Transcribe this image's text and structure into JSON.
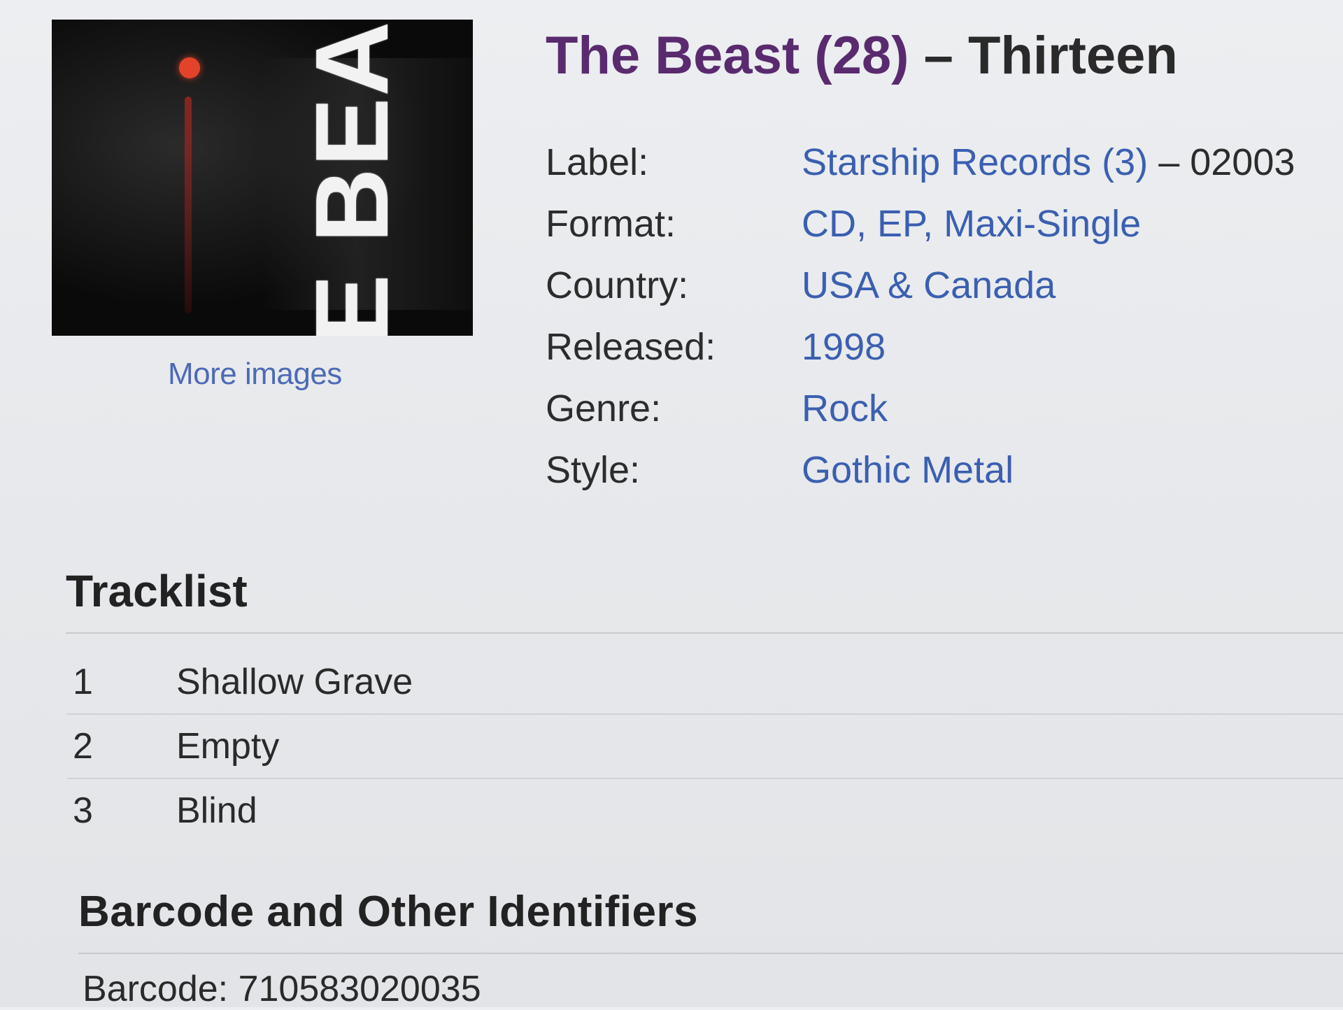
{
  "cover": {
    "logo_text": "THE BEAST",
    "more_images": "More images"
  },
  "release": {
    "artist": "The Beast (28)",
    "separator": "–",
    "title": "Thirteen"
  },
  "info": {
    "label_key": "Label:",
    "label_value": "Starship Records (3)",
    "label_catno": "– 02003",
    "format_key": "Format:",
    "format_value": "CD, EP, Maxi-Single",
    "country_key": "Country:",
    "country_value": "USA & Canada",
    "released_key": "Released:",
    "released_value": "1998",
    "genre_key": "Genre:",
    "genre_value": "Rock",
    "style_key": "Style:",
    "style_value": "Gothic Metal"
  },
  "tracklist": {
    "heading": "Tracklist",
    "tracks": [
      {
        "position": "1",
        "title": "Shallow Grave"
      },
      {
        "position": "2",
        "title": "Empty"
      },
      {
        "position": "3",
        "title": "Blind"
      }
    ]
  },
  "identifiers": {
    "heading": "Barcode and Other Identifiers",
    "barcode_line": "Barcode: 710583020035"
  },
  "colors": {
    "link": "#3b5fb0",
    "artist": "#5a2a6e",
    "text": "#2a2a2a",
    "background": "#e7e9ec"
  }
}
